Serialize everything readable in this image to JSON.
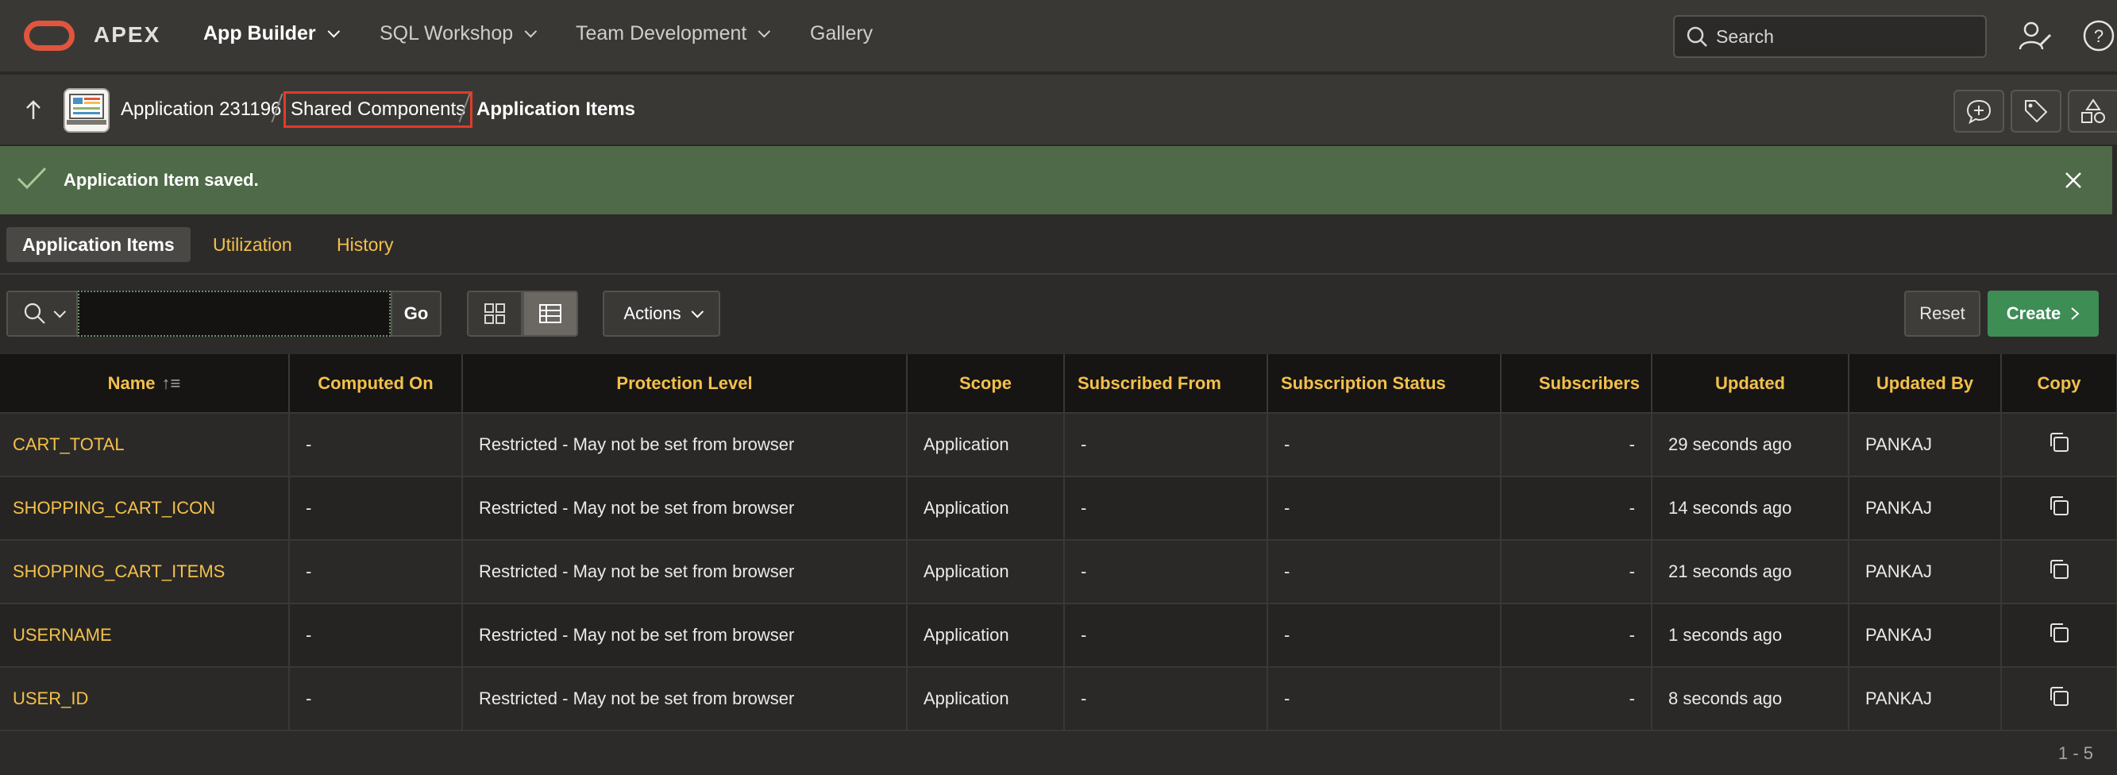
{
  "topnav": {
    "brand": "APEX",
    "items": [
      {
        "label": "App Builder"
      },
      {
        "label": "SQL Workshop"
      },
      {
        "label": "Team Development"
      },
      {
        "label": "Gallery"
      }
    ],
    "search_placeholder": "Search"
  },
  "breadcrumb": {
    "app": "Application 231196",
    "shared": "Shared Components",
    "current": "Application Items"
  },
  "banner": {
    "message": "Application Item saved."
  },
  "tabs": [
    {
      "label": "Application Items"
    },
    {
      "label": "Utilization"
    },
    {
      "label": "History"
    }
  ],
  "toolbar": {
    "go_label": "Go",
    "actions_label": "Actions",
    "reset_label": "Reset",
    "create_label": "Create",
    "search_value": ""
  },
  "table": {
    "columns": [
      "Name",
      "Computed On",
      "Protection Level",
      "Scope",
      "Subscribed From",
      "Subscription Status",
      "Subscribers",
      "Updated",
      "Updated By",
      "Copy"
    ],
    "rows": [
      {
        "name": "CART_TOTAL",
        "computed_on": "-",
        "protection": "Restricted - May not be set from browser",
        "scope": "Application",
        "subscribed_from": "-",
        "subscription_status": "-",
        "subscribers": "-",
        "updated": "29 seconds ago",
        "updated_by": "PANKAJ"
      },
      {
        "name": "SHOPPING_CART_ICON",
        "computed_on": "-",
        "protection": "Restricted - May not be set from browser",
        "scope": "Application",
        "subscribed_from": "-",
        "subscription_status": "-",
        "subscribers": "-",
        "updated": "14 seconds ago",
        "updated_by": "PANKAJ"
      },
      {
        "name": "SHOPPING_CART_ITEMS",
        "computed_on": "-",
        "protection": "Restricted - May not be set from browser",
        "scope": "Application",
        "subscribed_from": "-",
        "subscription_status": "-",
        "subscribers": "-",
        "updated": "21 seconds ago",
        "updated_by": "PANKAJ"
      },
      {
        "name": "USERNAME",
        "computed_on": "-",
        "protection": "Restricted - May not be set from browser",
        "scope": "Application",
        "subscribed_from": "-",
        "subscription_status": "-",
        "subscribers": "-",
        "updated": "1 seconds ago",
        "updated_by": "PANKAJ"
      },
      {
        "name": "USER_ID",
        "computed_on": "-",
        "protection": "Restricted - May not be set from browser",
        "scope": "Application",
        "subscribed_from": "-",
        "subscription_status": "-",
        "subscribers": "-",
        "updated": "8 seconds ago",
        "updated_by": "PANKAJ"
      }
    ]
  },
  "pagination": "1 - 5",
  "colors": {
    "accent": "#f3c04b",
    "success_banner": "#4f6a48",
    "create_button": "#3d8d55",
    "highlight_box": "#e03c2a"
  },
  "icons": [
    "oracle-logo-icon",
    "chevron-down-icon",
    "search-icon",
    "user-wrench-icon",
    "help-icon",
    "up-arrow-icon",
    "app-icon",
    "comment-plus-icon",
    "tag-icon",
    "shapes-icon",
    "check-icon",
    "close-icon",
    "grid-view-icon",
    "report-view-icon",
    "copy-icon",
    "sort-asc-icon",
    "chevron-right-icon"
  ]
}
